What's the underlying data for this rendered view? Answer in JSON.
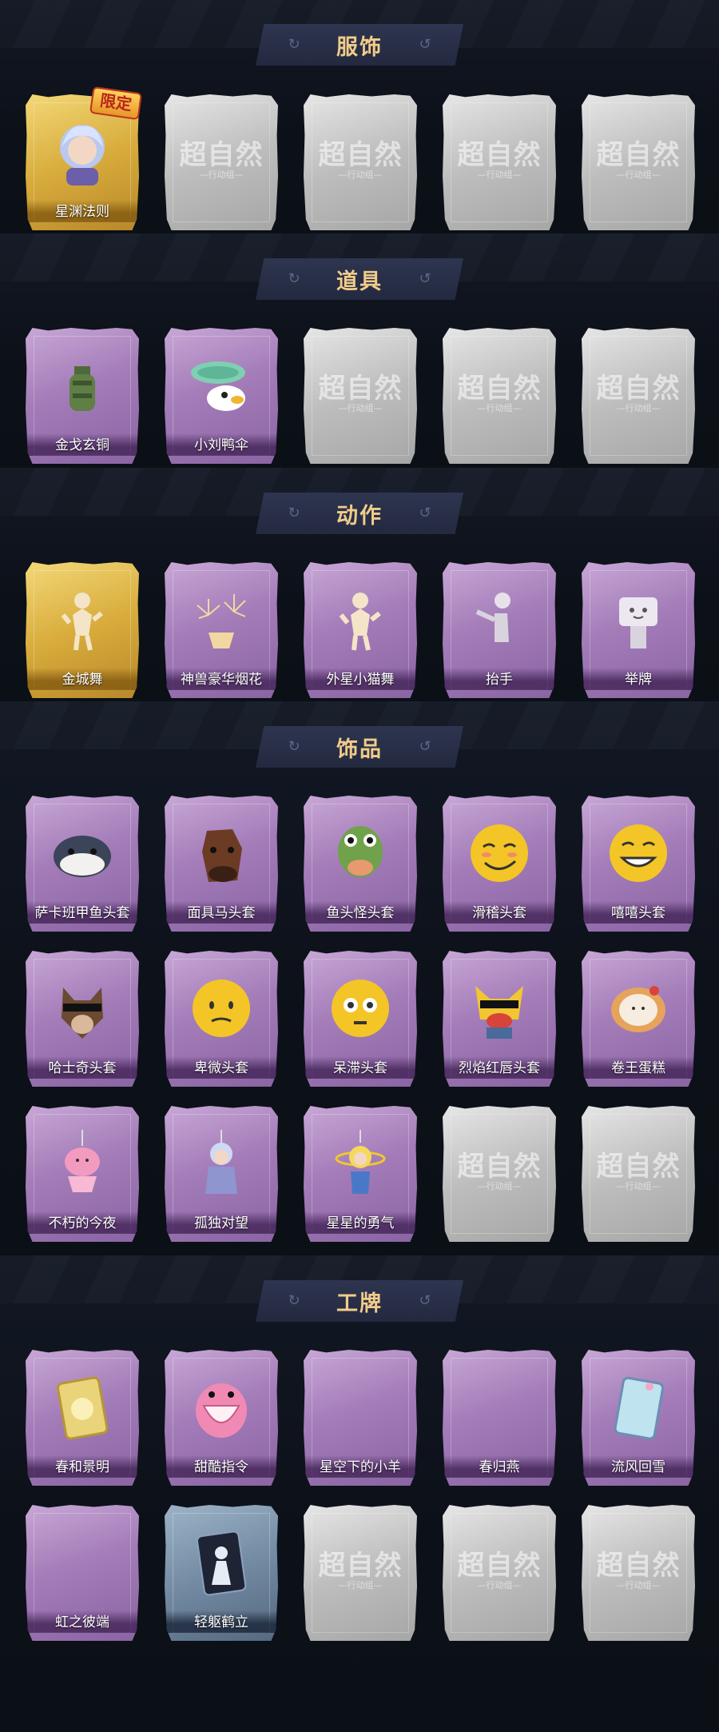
{
  "sections": [
    {
      "title": "服饰",
      "items": [
        {
          "label": "星渊法则",
          "style": "gold",
          "badge": "限定",
          "icon": "character-portrait-icon"
        },
        {
          "label": "",
          "style": "empty"
        },
        {
          "label": "",
          "style": "empty"
        },
        {
          "label": "",
          "style": "empty"
        },
        {
          "label": "",
          "style": "empty"
        }
      ]
    },
    {
      "title": "道具",
      "items": [
        {
          "label": "金戈玄铜",
          "style": "purple",
          "icon": "bronze-bottle-icon"
        },
        {
          "label": "小刘鸭伞",
          "style": "purple",
          "icon": "duck-umbrella-icon"
        },
        {
          "label": "",
          "style": "empty"
        },
        {
          "label": "",
          "style": "empty"
        },
        {
          "label": "",
          "style": "empty"
        }
      ]
    },
    {
      "title": "动作",
      "items": [
        {
          "label": "金城舞",
          "style": "gold",
          "icon": "dance-pose-icon"
        },
        {
          "label": "神兽豪华烟花",
          "style": "purple",
          "icon": "fireworks-icon"
        },
        {
          "label": "外星小猫舞",
          "style": "purple",
          "icon": "cat-dance-icon"
        },
        {
          "label": "抬手",
          "style": "purple",
          "icon": "raise-hand-icon"
        },
        {
          "label": "举牌",
          "style": "purple",
          "icon": "hold-sign-icon"
        }
      ]
    },
    {
      "title": "饰品",
      "items": [
        {
          "label": "萨卡班甲鱼头套",
          "style": "purple",
          "icon": "fish-head-icon"
        },
        {
          "label": "面具马头套",
          "style": "purple",
          "icon": "horse-head-icon"
        },
        {
          "label": "鱼头怪头套",
          "style": "purple",
          "icon": "fish-monster-head-icon"
        },
        {
          "label": "滑稽头套",
          "style": "purple",
          "icon": "funny-face-icon"
        },
        {
          "label": "嘻嘻头套",
          "style": "purple",
          "icon": "grin-face-icon"
        },
        {
          "label": "哈士奇头套",
          "style": "purple",
          "icon": "husky-head-icon"
        },
        {
          "label": "卑微头套",
          "style": "purple",
          "icon": "humble-face-icon"
        },
        {
          "label": "呆滞头套",
          "style": "purple",
          "icon": "dazed-face-icon"
        },
        {
          "label": "烈焰红唇头套",
          "style": "purple",
          "icon": "red-lips-head-icon"
        },
        {
          "label": "卷王蛋糕",
          "style": "purple",
          "icon": "roll-cake-icon"
        },
        {
          "label": "不朽的今夜",
          "style": "purple",
          "icon": "pink-charm-icon"
        },
        {
          "label": "孤独对望",
          "style": "purple",
          "icon": "doll-charm-icon"
        },
        {
          "label": "星星的勇气",
          "style": "purple",
          "icon": "star-charm-icon"
        },
        {
          "label": "",
          "style": "empty"
        },
        {
          "label": "",
          "style": "empty"
        }
      ]
    },
    {
      "title": "工牌",
      "items": [
        {
          "label": "春和景明",
          "style": "purple",
          "icon": "gold-badge-card-icon"
        },
        {
          "label": "甜酷指令",
          "style": "purple",
          "icon": "pink-monster-card-icon"
        },
        {
          "label": "星空下的小羊",
          "style": "purple",
          "icon": ""
        },
        {
          "label": "春归燕",
          "style": "purple",
          "icon": ""
        },
        {
          "label": "流风回雪",
          "style": "purple",
          "icon": "blue-card-icon"
        },
        {
          "label": "虹之彼端",
          "style": "purple",
          "icon": ""
        },
        {
          "label": "轻躯鹤立",
          "style": "blue",
          "icon": "silhouette-card-icon"
        },
        {
          "label": "",
          "style": "empty"
        },
        {
          "label": "",
          "style": "empty"
        },
        {
          "label": "",
          "style": "empty"
        }
      ]
    }
  ],
  "placeholder": {
    "main": "超自然",
    "sub": "—行动组—"
  },
  "colors": {
    "section_title": "#f1cc8a",
    "background": "#0d1119",
    "card_purple": "#a37cb8",
    "card_gold": "#d8ac3c"
  }
}
